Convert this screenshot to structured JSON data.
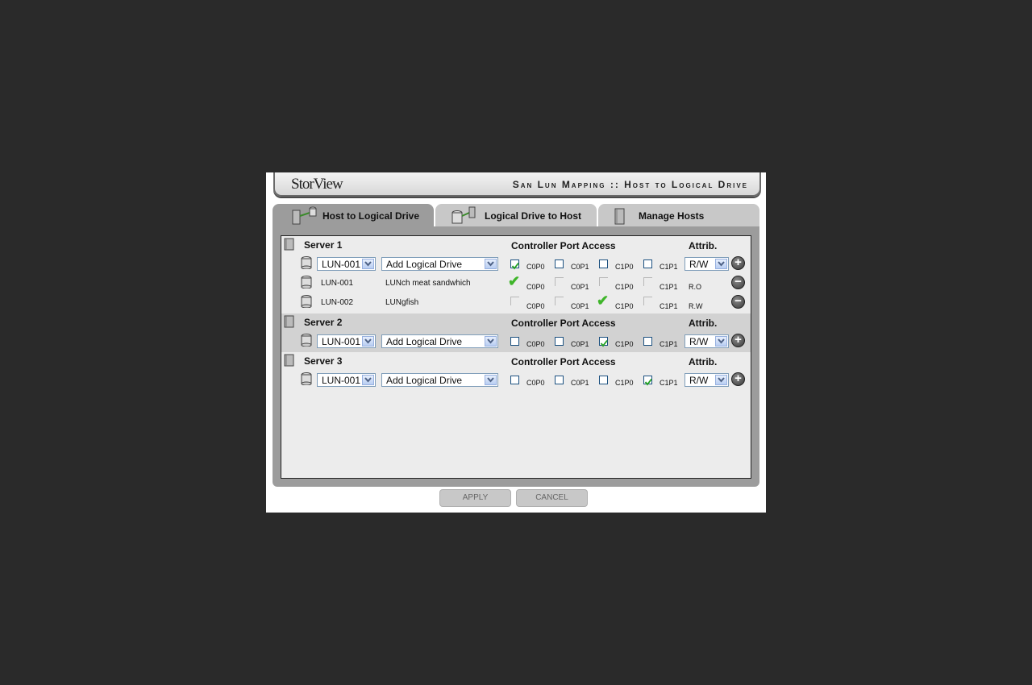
{
  "header": {
    "logo": "StorView",
    "title": "San Lun Mapping :: Host to Logical Drive"
  },
  "tabs": [
    {
      "label": "Host to Logical Drive",
      "active": true
    },
    {
      "label": "Logical Drive to Host",
      "active": false
    },
    {
      "label": "Manage Hosts",
      "active": false
    }
  ],
  "columns": {
    "controller_port_access": "Controller Port Access",
    "attrib": "Attrib."
  },
  "ports": [
    "C0P0",
    "C0P1",
    "C1P0",
    "C1P1"
  ],
  "servers": [
    {
      "name": "Server 1",
      "lun_select": "LUN-001",
      "drive_select": "Add Logical Drive",
      "ports_checked": [
        true,
        false,
        false,
        false
      ],
      "attrib": "R/W",
      "mapped": [
        {
          "lun": "LUN-001",
          "name": "LUNch meat sandwhich",
          "ports": [
            true,
            false,
            false,
            false
          ],
          "attrib": "R.O"
        },
        {
          "lun": "LUN-002",
          "name": "LUNgfish",
          "ports": [
            false,
            false,
            true,
            false
          ],
          "attrib": "R.W"
        }
      ]
    },
    {
      "name": "Server 2",
      "lun_select": "LUN-001",
      "drive_select": "Add Logical Drive",
      "ports_checked": [
        false,
        false,
        true,
        false
      ],
      "attrib": "R/W",
      "mapped": []
    },
    {
      "name": "Server 3",
      "lun_select": "LUN-001",
      "drive_select": "Add Logical Drive",
      "ports_checked": [
        false,
        false,
        false,
        true
      ],
      "attrib": "R/W",
      "mapped": []
    }
  ],
  "buttons": {
    "apply": "APPLY",
    "cancel": "CANCEL"
  },
  "colors": {
    "check_green": "#3fb52a",
    "panel_gray": "#9c9c9c",
    "tab_gray": "#c8c8c8"
  }
}
